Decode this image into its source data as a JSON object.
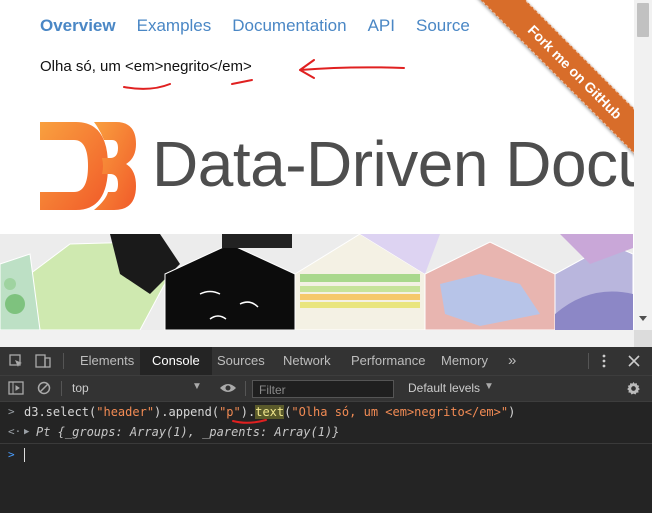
{
  "nav": {
    "items": [
      {
        "label": "Overview",
        "active": true
      },
      {
        "label": "Examples"
      },
      {
        "label": "Documentation"
      },
      {
        "label": "API"
      },
      {
        "label": "Source"
      }
    ]
  },
  "content": {
    "paragraph_text": "Olha só, um <em>negrito</em>",
    "logo_title": "Data-Driven Docur"
  },
  "ribbon": {
    "label": "Fork me on GitHub"
  },
  "devtools": {
    "tabs": [
      "Elements",
      "Console",
      "Sources",
      "Network",
      "Performance",
      "Memory"
    ],
    "active_tab": "Console",
    "more_tabs": "»",
    "toolbar": {
      "context": "top",
      "filter_placeholder": "Filter",
      "levels": "Default levels"
    },
    "console": {
      "input_line": "d3.select(\"header\").append(\"p\").text(\"Olha só, um <em>negrito</em>\")",
      "input_parts": {
        "p1": "d3.select(",
        "p2": "\"header\"",
        "p3": ").append(",
        "p4": "\"p\"",
        "p5": ").",
        "p6": "text",
        "p7": "(",
        "p8": "\"Olha só, um <em>negrito</em>\"",
        "p9": ")"
      },
      "output_line": "Pt {_groups: Array(1), _parents: Array(1)}"
    }
  },
  "colors": {
    "link": "#4a87c5",
    "ribbon": "#d86d2a",
    "d3_orange": "#f3763a",
    "annotation_red": "#e02020",
    "devtools_bg": "#242424"
  }
}
